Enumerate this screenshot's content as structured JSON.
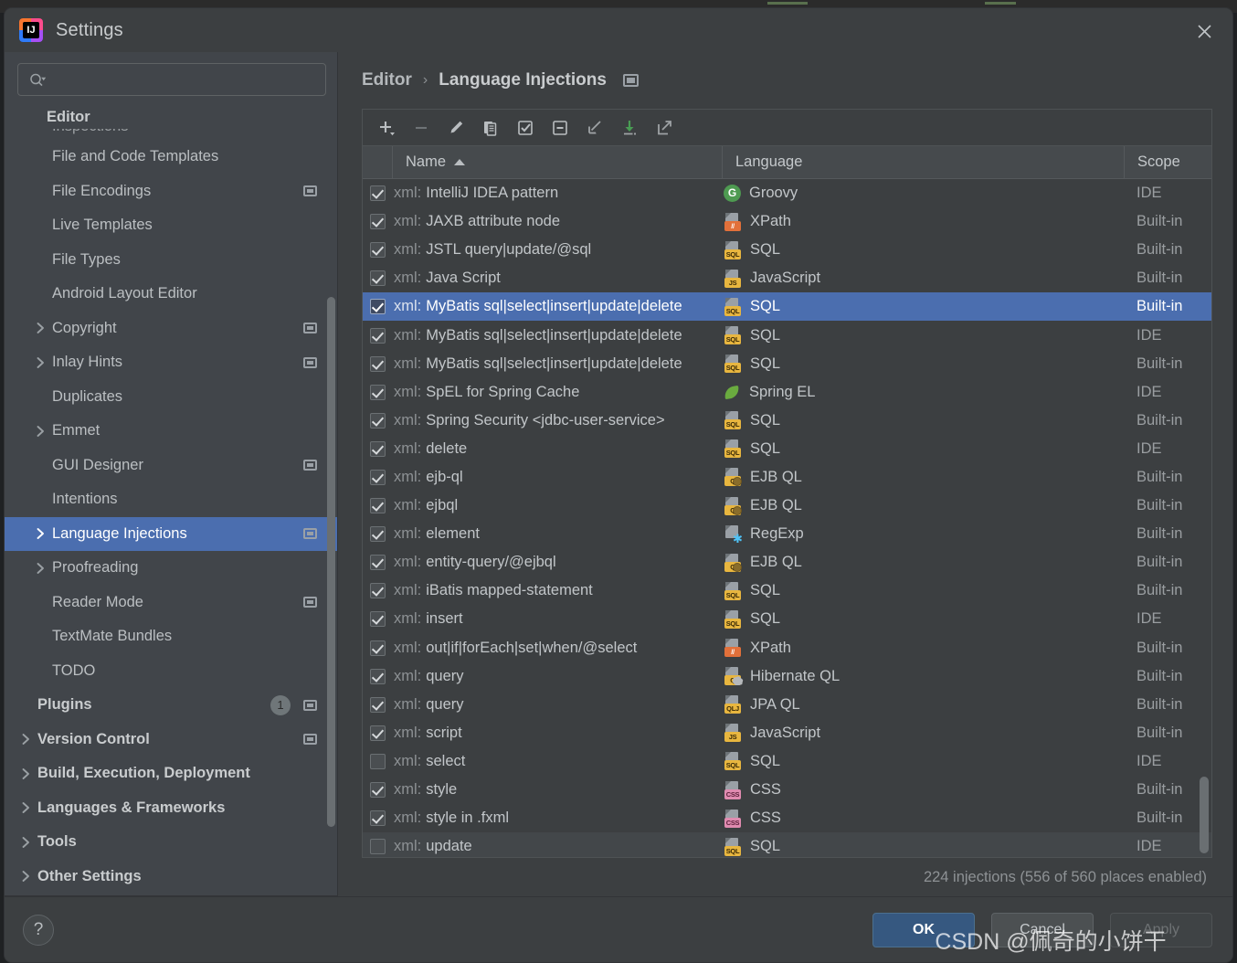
{
  "window": {
    "title": "Settings",
    "logo_letters": "IJ",
    "close_icon": "close-icon"
  },
  "sidebar": {
    "search": {
      "value": "",
      "placeholder": "",
      "icon": "search-icon"
    },
    "group_header": "Editor",
    "items": [
      {
        "label": "Inspections",
        "level": 1,
        "expandable": false,
        "badge": "dash",
        "clipped": true
      },
      {
        "label": "File and Code Templates",
        "level": 1,
        "expandable": false,
        "badge": null
      },
      {
        "label": "File Encodings",
        "level": 1,
        "expandable": false,
        "badge": "square"
      },
      {
        "label": "Live Templates",
        "level": 1,
        "expandable": false,
        "badge": null
      },
      {
        "label": "File Types",
        "level": 1,
        "expandable": false,
        "badge": null
      },
      {
        "label": "Android Layout Editor",
        "level": 1,
        "expandable": false,
        "badge": null
      },
      {
        "label": "Copyright",
        "level": 1,
        "expandable": true,
        "badge": "square"
      },
      {
        "label": "Inlay Hints",
        "level": 1,
        "expandable": true,
        "badge": "square"
      },
      {
        "label": "Duplicates",
        "level": 1,
        "expandable": false,
        "badge": null
      },
      {
        "label": "Emmet",
        "level": 1,
        "expandable": true,
        "badge": null
      },
      {
        "label": "GUI Designer",
        "level": 1,
        "expandable": false,
        "badge": "square"
      },
      {
        "label": "Intentions",
        "level": 1,
        "expandable": false,
        "badge": null
      },
      {
        "label": "Language Injections",
        "level": 1,
        "expandable": true,
        "badge": "square",
        "selected": true
      },
      {
        "label": "Proofreading",
        "level": 1,
        "expandable": true,
        "badge": null
      },
      {
        "label": "Reader Mode",
        "level": 1,
        "expandable": false,
        "badge": "square"
      },
      {
        "label": "TextMate Bundles",
        "level": 1,
        "expandable": false,
        "badge": null
      },
      {
        "label": "TODO",
        "level": 1,
        "expandable": false,
        "badge": null
      },
      {
        "label": "Plugins",
        "level": 0,
        "expandable": false,
        "badge": "square",
        "count": "1",
        "root": true
      },
      {
        "label": "Version Control",
        "level": 0,
        "expandable": true,
        "badge": "square",
        "root": true
      },
      {
        "label": "Build, Execution, Deployment",
        "level": 0,
        "expandable": true,
        "badge": null,
        "root": true
      },
      {
        "label": "Languages & Frameworks",
        "level": 0,
        "expandable": true,
        "badge": null,
        "root": true
      },
      {
        "label": "Tools",
        "level": 0,
        "expandable": true,
        "badge": null,
        "root": true
      },
      {
        "label": "Other Settings",
        "level": 0,
        "expandable": true,
        "badge": null,
        "root": true
      }
    ]
  },
  "breadcrumb": {
    "parent": "Editor",
    "separator": "›",
    "current": "Language Injections",
    "badge_icon": "ide-scope-badge-icon"
  },
  "toolbar": {
    "buttons": [
      {
        "name": "add-button",
        "title": "Add",
        "enabled": true
      },
      {
        "name": "remove-button",
        "title": "Remove",
        "enabled": false
      },
      {
        "name": "edit-button",
        "title": "Edit",
        "enabled": true
      },
      {
        "name": "duplicate-button",
        "title": "Duplicate",
        "enabled": true
      },
      {
        "name": "enable-selected-button",
        "title": "Enable Selected Injections",
        "enabled": true
      },
      {
        "name": "disable-selected-button",
        "title": "Disable Selected Injections",
        "enabled": true
      },
      {
        "name": "revert-button",
        "title": "Revert",
        "enabled": true
      },
      {
        "name": "import-button",
        "title": "Import",
        "enabled": true
      },
      {
        "name": "export-button",
        "title": "Export",
        "enabled": true
      }
    ]
  },
  "table": {
    "columns": [
      {
        "key": "name",
        "label": "Name",
        "sorted": "asc"
      },
      {
        "key": "lang",
        "label": "Language",
        "sorted": null
      },
      {
        "key": "scope",
        "label": "Scope",
        "sorted": null
      }
    ],
    "rows": [
      {
        "checked": true,
        "prefix": "xml:",
        "name": "IntelliJ IDEA pattern",
        "lang": "Groovy",
        "icon": "groovy-icon",
        "scope": "IDE"
      },
      {
        "checked": true,
        "prefix": "xml:",
        "name": "JAXB attribute node",
        "lang": "XPath",
        "icon": "xpath-icon",
        "scope": "Built-in"
      },
      {
        "checked": true,
        "prefix": "xml:",
        "name": "JSTL query|update/@sql",
        "lang": "SQL",
        "icon": "sql-icon",
        "scope": "Built-in"
      },
      {
        "checked": true,
        "prefix": "xml:",
        "name": "Java Script",
        "lang": "JavaScript",
        "icon": "js-icon",
        "scope": "Built-in"
      },
      {
        "checked": true,
        "prefix": "xml:",
        "name": "MyBatis sql|select|insert|update|delete",
        "lang": "SQL",
        "icon": "sql-icon",
        "scope": "Built-in",
        "selected": true
      },
      {
        "checked": true,
        "prefix": "xml:",
        "name": "MyBatis sql|select|insert|update|delete",
        "lang": "SQL",
        "icon": "sql-icon",
        "scope": "IDE"
      },
      {
        "checked": true,
        "prefix": "xml:",
        "name": "MyBatis sql|select|insert|update|delete",
        "lang": "SQL",
        "icon": "sql-icon",
        "scope": "Built-in"
      },
      {
        "checked": true,
        "prefix": "xml:",
        "name": "SpEL for Spring Cache",
        "lang": "Spring EL",
        "icon": "spring-icon",
        "scope": "IDE"
      },
      {
        "checked": true,
        "prefix": "xml:",
        "name": "Spring Security <jdbc-user-service>",
        "lang": "SQL",
        "icon": "sql-icon",
        "scope": "Built-in"
      },
      {
        "checked": true,
        "prefix": "xml:",
        "name": "delete",
        "lang": "SQL",
        "icon": "sql-icon",
        "scope": "IDE"
      },
      {
        "checked": true,
        "prefix": "xml:",
        "name": "ejb-ql",
        "lang": "EJB QL",
        "icon": "ejbql-icon",
        "scope": "Built-in"
      },
      {
        "checked": true,
        "prefix": "xml:",
        "name": "ejbql",
        "lang": "EJB QL",
        "icon": "ejbql-icon",
        "scope": "Built-in"
      },
      {
        "checked": true,
        "prefix": "xml:",
        "name": "element",
        "lang": "RegExp",
        "icon": "regexp-icon",
        "scope": "Built-in"
      },
      {
        "checked": true,
        "prefix": "xml:",
        "name": "entity-query/@ejbql",
        "lang": "EJB QL",
        "icon": "ejbql-icon",
        "scope": "Built-in"
      },
      {
        "checked": true,
        "prefix": "xml:",
        "name": "iBatis mapped-statement",
        "lang": "SQL",
        "icon": "sql-icon",
        "scope": "Built-in"
      },
      {
        "checked": true,
        "prefix": "xml:",
        "name": "insert",
        "lang": "SQL",
        "icon": "sql-icon",
        "scope": "IDE"
      },
      {
        "checked": true,
        "prefix": "xml:",
        "name": "out|if|forEach|set|when/@select",
        "lang": "XPath",
        "icon": "xpath-icon",
        "scope": "Built-in"
      },
      {
        "checked": true,
        "prefix": "xml:",
        "name": "query",
        "lang": "Hibernate QL",
        "icon": "hibernate-icon",
        "scope": "Built-in"
      },
      {
        "checked": true,
        "prefix": "xml:",
        "name": "query",
        "lang": "JPA QL",
        "icon": "jpaql-icon",
        "scope": "Built-in"
      },
      {
        "checked": true,
        "prefix": "xml:",
        "name": "script",
        "lang": "JavaScript",
        "icon": "js-icon",
        "scope": "Built-in"
      },
      {
        "checked": false,
        "prefix": "xml:",
        "name": "select",
        "lang": "SQL",
        "icon": "sql-icon",
        "scope": "IDE"
      },
      {
        "checked": true,
        "prefix": "xml:",
        "name": "style",
        "lang": "CSS",
        "icon": "css-icon",
        "scope": "Built-in"
      },
      {
        "checked": true,
        "prefix": "xml:",
        "name": "style in .fxml",
        "lang": "CSS",
        "icon": "css-icon",
        "scope": "Built-in"
      },
      {
        "checked": false,
        "prefix": "xml:",
        "name": "update",
        "lang": "SQL",
        "icon": "sql-icon",
        "scope": "IDE",
        "hover": true
      }
    ]
  },
  "status": {
    "text": "224 injections (556 of 560 places enabled)"
  },
  "footer": {
    "help_label": "?",
    "ok_label": "OK",
    "cancel_label": "Cancel",
    "apply_label": "Apply"
  },
  "watermark": {
    "text": "CSDN @佩奇的小饼干"
  },
  "colors": {
    "accent_selection": "#4b6eaf",
    "primary_button": "#365880",
    "dialog_bg": "#3c3f41",
    "sidebar_bg": "#41454a"
  }
}
